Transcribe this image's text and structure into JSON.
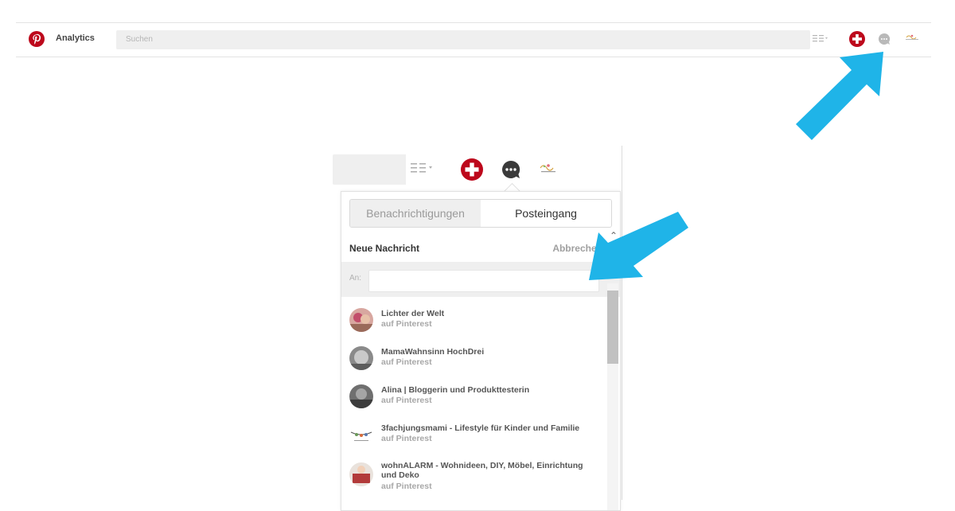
{
  "topbar": {
    "app_label": "Analytics",
    "search_placeholder": "Suchen"
  },
  "panel": {
    "tabs": [
      {
        "label": "Benachrichtigungen",
        "active": false
      },
      {
        "label": "Posteingang",
        "active": true
      }
    ],
    "new_message_title": "Neue Nachricht",
    "cancel_label": "Abbrechen",
    "to_label": "An:",
    "to_value": ""
  },
  "contacts": [
    {
      "name": "Lichter der Welt",
      "subtitle": "auf Pinterest"
    },
    {
      "name": "MamaWahnsinn HochDrei",
      "subtitle": "auf Pinterest"
    },
    {
      "name": "Alina | Bloggerin und Produkttesterin",
      "subtitle": "auf Pinterest"
    },
    {
      "name": "3fachjungsmami - Lifestyle für Kinder und Familie",
      "subtitle": "auf Pinterest"
    },
    {
      "name": "wohnALARM - Wohnideen, DIY, Möbel, Einrichtung und Deko",
      "subtitle": "auf Pinterest"
    }
  ],
  "colors": {
    "pinterest_red": "#bd081c",
    "arrow_blue": "#1fb4e8",
    "chat_grey": "#333333"
  },
  "icons": {
    "logo": "pinterest-logo-icon",
    "menu": "list-menu-icon",
    "add": "plus-circle-icon",
    "chat": "chat-bubble-icon",
    "profile": "profile-avatar-icon"
  }
}
